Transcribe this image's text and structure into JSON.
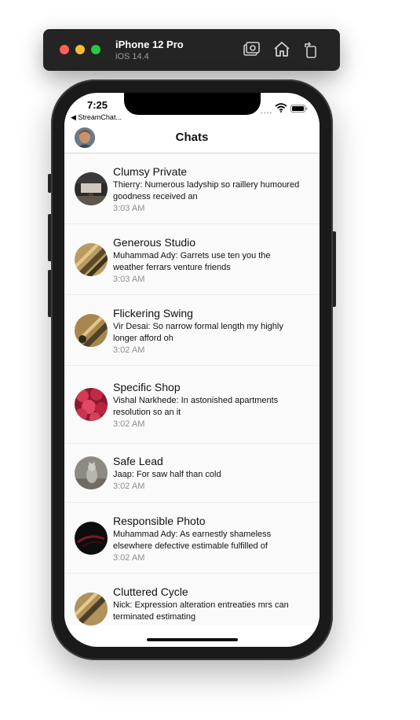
{
  "simulator": {
    "device_name": "iPhone 12 Pro",
    "os_version": "iOS 14.4",
    "icons": [
      "screenshot-icon",
      "home-icon",
      "rotate-icon"
    ]
  },
  "status_bar": {
    "time": "7:25",
    "back_app": "◀ StreamChat..."
  },
  "nav": {
    "title": "Chats"
  },
  "chats": [
    {
      "name": "Clumsy Private",
      "message": "Thierry: Numerous ladyship so raillery humoured goodness received an",
      "time": "3:03 AM"
    },
    {
      "name": "Generous Studio",
      "message": "Muhammad Ady: Garrets use ten you the weather ferrars venture friends",
      "time": "3:03 AM"
    },
    {
      "name": "Flickering Swing",
      "message": "Vir Desai: So narrow formal length my highly longer afford oh",
      "time": "3:02 AM"
    },
    {
      "name": "Specific Shop",
      "message": "Vishal Narkhede: In astonished apartments resolution so an it",
      "time": "3:02 AM"
    },
    {
      "name": "Safe Lead",
      "message": "Jaap: For saw half than cold",
      "time": "3:02 AM"
    },
    {
      "name": "Responsible Photo",
      "message": "Muhammad Ady: As earnestly shameless elsewhere defective estimable fulfilled of",
      "time": "3:02 AM"
    },
    {
      "name": "Cluttered Cycle",
      "message": "Nick: Expression alteration entreaties mrs can terminated estimating",
      "time": ""
    }
  ],
  "colors": {
    "accent_close": "#fe5f57",
    "accent_min": "#febc2e",
    "accent_max": "#28c840",
    "time_gray": "#8e8e93"
  }
}
